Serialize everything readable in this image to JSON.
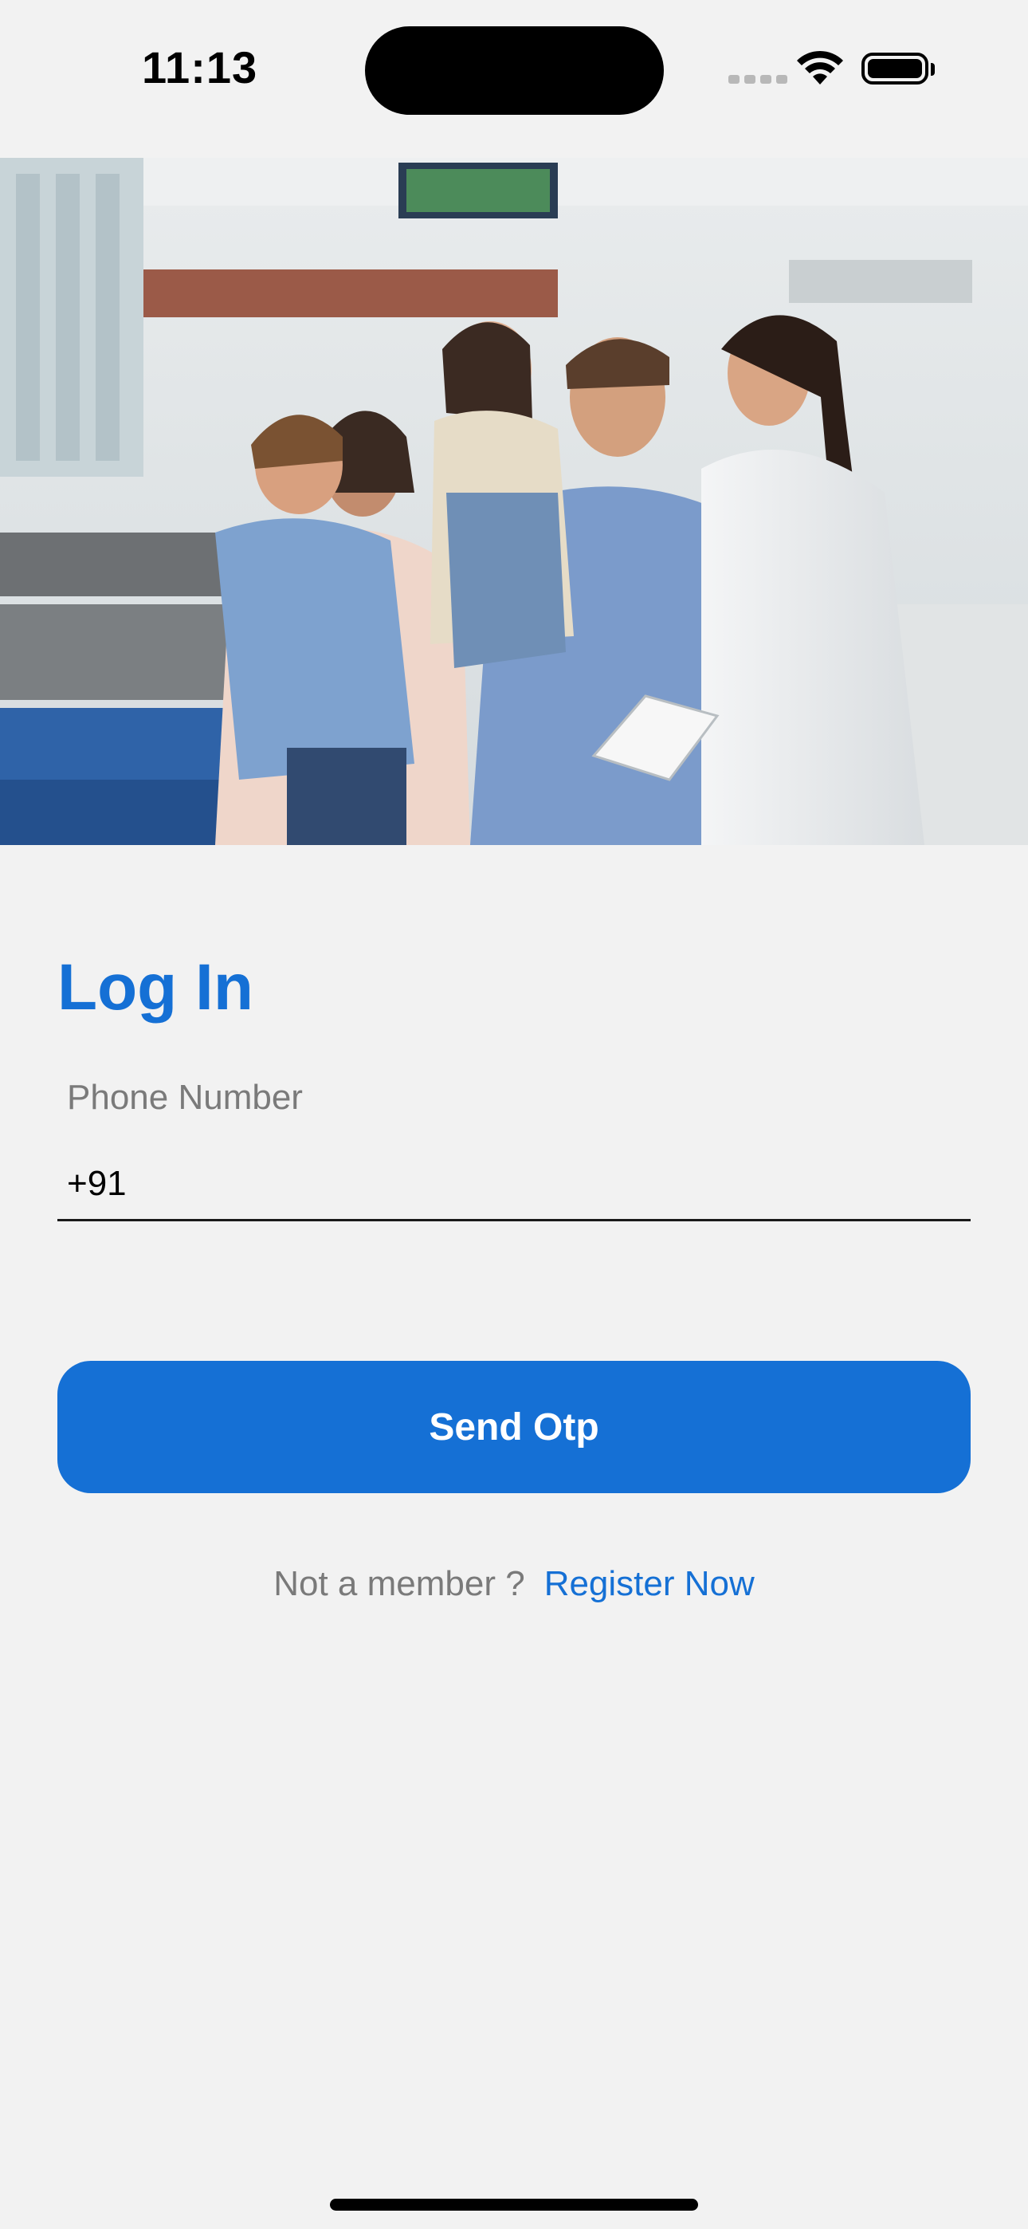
{
  "status_bar": {
    "time": "11:13"
  },
  "hero": {
    "alt": "Family with children talking with a doctor"
  },
  "login": {
    "title": "Log In",
    "phone_label": "Phone Number",
    "phone_value": "+91",
    "send_otp_label": "Send Otp",
    "not_member_text": "Not a member ?",
    "register_link": "Register Now"
  },
  "colors": {
    "accent": "#1570d5",
    "background": "#f2f2f2",
    "muted_text": "#7a7a7a"
  },
  "icons": [
    "cellular-signal-icon",
    "wifi-icon",
    "battery-icon"
  ]
}
